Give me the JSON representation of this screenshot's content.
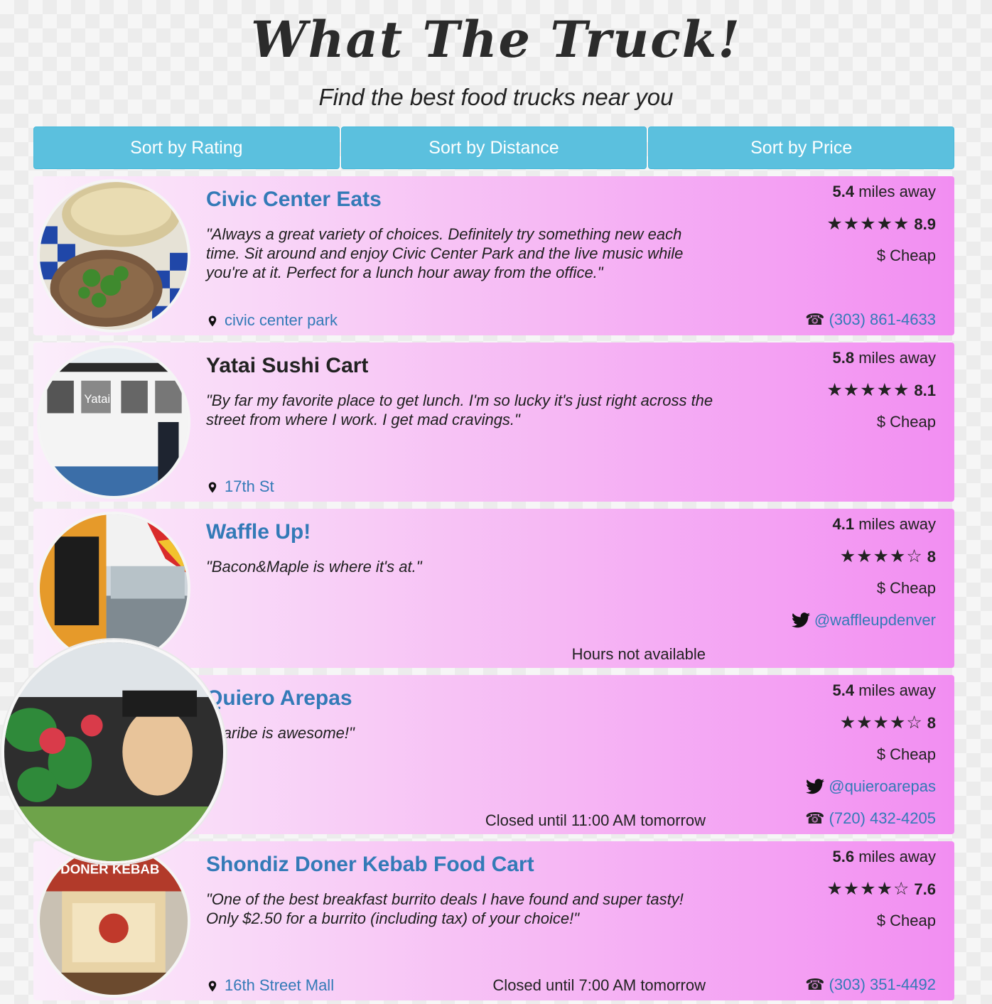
{
  "app": {
    "title": "What The Truck!",
    "subtitle": "Find the best food trucks near you"
  },
  "sort_buttons": [
    "Sort by Rating",
    "Sort by Distance",
    "Sort by Price"
  ],
  "trucks": [
    {
      "name": "Civic Center Eats",
      "name_is_link": true,
      "review": "\"Always a great variety of choices. Definitely try something new each time. Sit around and enjoy Civic Center Park and the live music while you're at it. Perfect for a lunch hour away from the office.\"",
      "location": "civic center park",
      "hours": "",
      "distance_value": "5.4",
      "distance_unit": "miles away",
      "stars": "★★★★★",
      "rating": "8.9",
      "price": "$ Cheap",
      "twitter": "",
      "phone": "(303) 861-4633",
      "photo_icon": "burger-photo"
    },
    {
      "name": "Yatai Sushi Cart",
      "name_is_link": false,
      "review": "\"By far my favorite place to get lunch. I'm so lucky it's just right across the street from where I work. I get mad cravings.\"",
      "location": "17th St",
      "hours": "",
      "distance_value": "5.8",
      "distance_unit": "miles away",
      "stars": "★★★★★",
      "rating": "8.1",
      "price": "$ Cheap",
      "twitter": "",
      "phone": "",
      "photo_icon": "sushi-cart-photo",
      "photo_text": "Yatai"
    },
    {
      "name": "Waffle Up!",
      "name_is_link": true,
      "review": "\"Bacon&Maple is where it's at.\"",
      "location": "",
      "hours": "Hours not available",
      "distance_value": "4.1",
      "distance_unit": "miles away",
      "stars": "★★★★☆",
      "rating": "8",
      "price": "$ Cheap",
      "twitter": "@waffleupdenver",
      "phone": "",
      "photo_icon": "waffle-truck-photo"
    },
    {
      "name": "Quiero Arepas",
      "name_is_link": true,
      "review": "\"Caribe is awesome!\"",
      "location": "",
      "hours": "Closed until 11:00 AM tomorrow",
      "distance_value": "5.4",
      "distance_unit": "miles away",
      "stars": "★★★★☆",
      "rating": "8",
      "price": "$ Cheap",
      "twitter": "@quieroarepas",
      "phone": "(720) 432-4205",
      "photo_icon": "arepas-truck-photo"
    },
    {
      "name": "Shondiz Doner Kebab Food Cart",
      "name_is_link": true,
      "review": "\"One of the best breakfast burrito deals I have found and super tasty! Only $2.50 for a burrito (including tax) of your choice!\"",
      "location": "16th Street Mall",
      "hours": "Closed until 7:00 AM tomorrow",
      "distance_value": "5.6",
      "distance_unit": "miles away",
      "stars": "★★★★☆",
      "rating": "7.6",
      "price": "$ Cheap",
      "twitter": "",
      "phone": "(303) 351-4492",
      "photo_icon": "kebab-cart-photo",
      "photo_text": "DONER KEBAB"
    }
  ],
  "icons": {
    "location": "map-pin-icon",
    "phone": "☎",
    "twitter": "twitter-bird-icon"
  },
  "colors": {
    "accent": "#5bc0de",
    "link": "#337ab7",
    "card_gradient_start": "#fbeefb",
    "card_gradient_end": "#f28ef2"
  }
}
